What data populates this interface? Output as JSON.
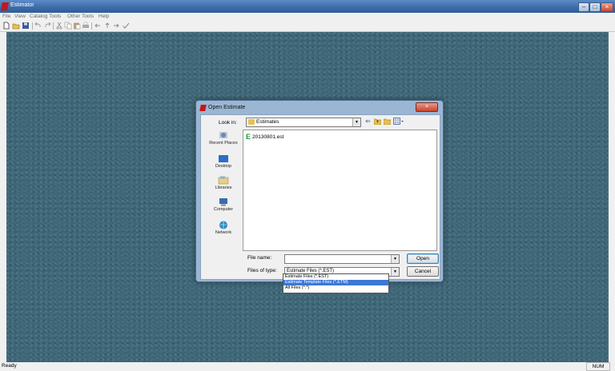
{
  "window": {
    "title": "Estimator",
    "controls": [
      "–",
      "□",
      "×"
    ]
  },
  "menu": [
    "File",
    "View",
    "Catalog Tools",
    "Other Tools",
    "Help"
  ],
  "toolbar_icons": [
    "new-file-icon",
    "open-folder-icon",
    "save-icon",
    "undo-icon",
    "redo-icon",
    "cut-icon",
    "copy-icon",
    "paste-icon",
    "print-icon",
    "back-arrow-icon",
    "up-arrow-icon",
    "right-arrow-icon",
    "checkmark-icon"
  ],
  "dialog": {
    "title": "Open Estimate",
    "close_glyph": "×",
    "look_in_label": "Look in:",
    "look_in_value": "Estimates",
    "places": [
      "Recent Places",
      "Desktop",
      "Libraries",
      "Computer",
      "Network"
    ],
    "files": [
      "20130801.est"
    ],
    "file_name_label": "File name:",
    "file_name_value": "",
    "files_of_type_label": "Files of type:",
    "files_of_type_value": "Estimate Files (*.EST)",
    "open_label": "Open",
    "cancel_label": "Cancel",
    "type_options": [
      "Estimate Files (*.EST)",
      "Estimate Template Files (*.ETM)",
      "All Files (*.*)"
    ],
    "selected_type_index": 1
  },
  "status": {
    "text": "Ready",
    "num": "NUM"
  }
}
